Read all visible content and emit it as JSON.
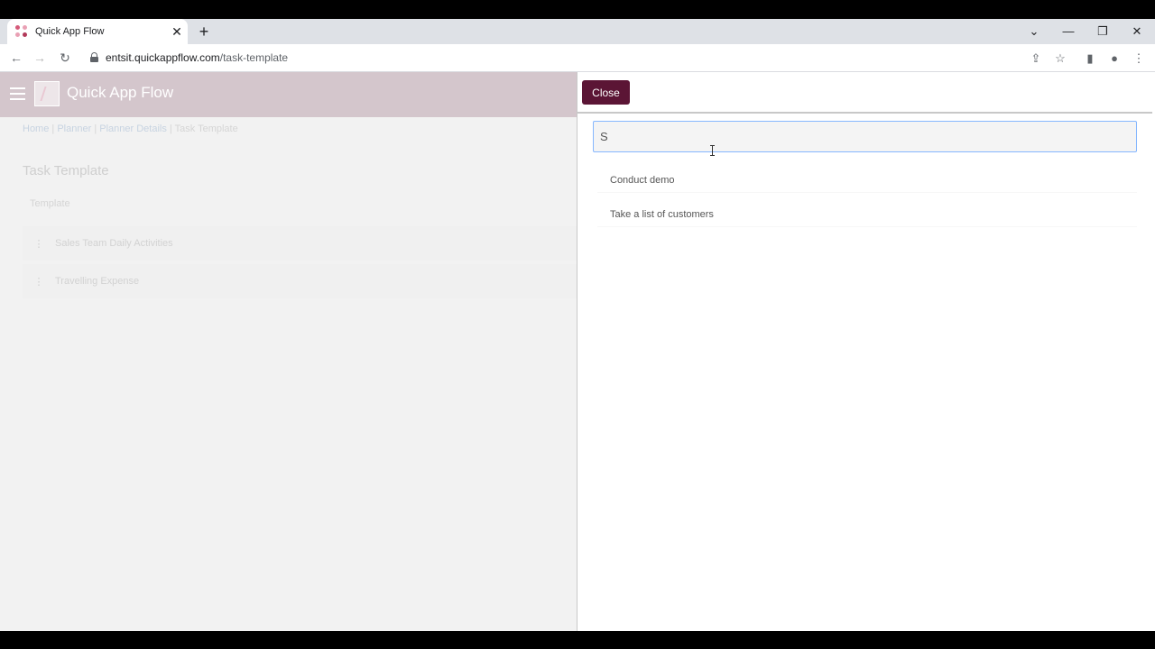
{
  "browser": {
    "tab_title": "Quick App Flow",
    "tab_close": "✕",
    "new_tab": "+",
    "url_host": "entsit.quickappflow.com",
    "url_path": "/task-template",
    "controls": {
      "list": "⌄",
      "minimize": "—",
      "restore": "❐",
      "close": "✕"
    },
    "nav": {
      "back": "←",
      "forward": "→",
      "reload": "↻"
    },
    "toolbar_icons": {
      "share": "⇪",
      "star": "☆",
      "sidepanel": "▮",
      "profile": "●",
      "menu": "⋮"
    }
  },
  "app": {
    "name": "Quick App Flow",
    "breadcrumb": {
      "home": "Home",
      "planner": "Planner",
      "planner_details": "Planner Details",
      "current": "Task Template",
      "sep": "|"
    },
    "page_title": "Task Template",
    "table_label": "Template",
    "templates": [
      {
        "dots": "⋮",
        "name": "Sales Team Daily Activities"
      },
      {
        "dots": "⋮",
        "name": "Travelling Expense"
      }
    ]
  },
  "panel": {
    "close_label": "Close",
    "search_value": "S",
    "results": [
      {
        "label": "Conduct demo"
      },
      {
        "label": "Take a list of customers"
      }
    ]
  }
}
